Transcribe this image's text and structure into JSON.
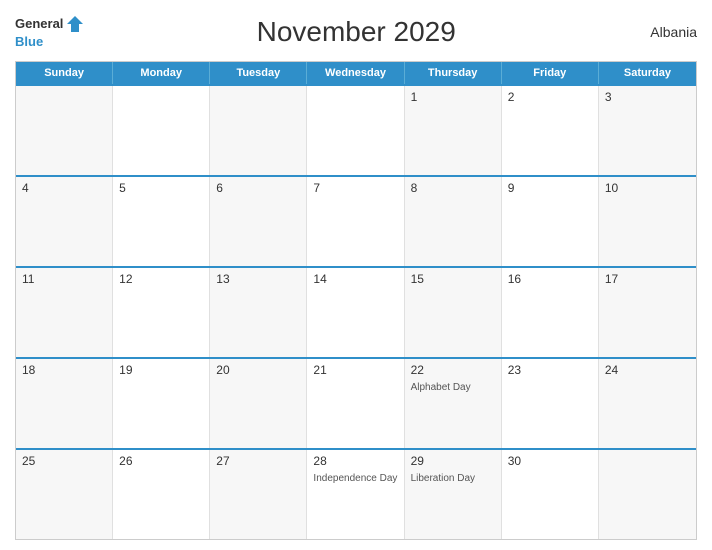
{
  "header": {
    "title": "November 2029",
    "country": "Albania",
    "logo": {
      "general": "General",
      "blue": "Blue"
    }
  },
  "calendar": {
    "days_of_week": [
      "Sunday",
      "Monday",
      "Tuesday",
      "Wednesday",
      "Thursday",
      "Friday",
      "Saturday"
    ],
    "weeks": [
      [
        {
          "day": "",
          "events": []
        },
        {
          "day": "",
          "events": []
        },
        {
          "day": "",
          "events": []
        },
        {
          "day": "",
          "events": []
        },
        {
          "day": "1",
          "events": []
        },
        {
          "day": "2",
          "events": []
        },
        {
          "day": "3",
          "events": []
        }
      ],
      [
        {
          "day": "4",
          "events": []
        },
        {
          "day": "5",
          "events": []
        },
        {
          "day": "6",
          "events": []
        },
        {
          "day": "7",
          "events": []
        },
        {
          "day": "8",
          "events": []
        },
        {
          "day": "9",
          "events": []
        },
        {
          "day": "10",
          "events": []
        }
      ],
      [
        {
          "day": "11",
          "events": []
        },
        {
          "day": "12",
          "events": []
        },
        {
          "day": "13",
          "events": []
        },
        {
          "day": "14",
          "events": []
        },
        {
          "day": "15",
          "events": []
        },
        {
          "day": "16",
          "events": []
        },
        {
          "day": "17",
          "events": []
        }
      ],
      [
        {
          "day": "18",
          "events": []
        },
        {
          "day": "19",
          "events": []
        },
        {
          "day": "20",
          "events": []
        },
        {
          "day": "21",
          "events": []
        },
        {
          "day": "22",
          "events": [
            "Alphabet Day"
          ]
        },
        {
          "day": "23",
          "events": []
        },
        {
          "day": "24",
          "events": []
        }
      ],
      [
        {
          "day": "25",
          "events": []
        },
        {
          "day": "26",
          "events": []
        },
        {
          "day": "27",
          "events": []
        },
        {
          "day": "28",
          "events": [
            "Independence Day"
          ]
        },
        {
          "day": "29",
          "events": [
            "Liberation Day"
          ]
        },
        {
          "day": "30",
          "events": []
        },
        {
          "day": "",
          "events": []
        }
      ]
    ]
  }
}
